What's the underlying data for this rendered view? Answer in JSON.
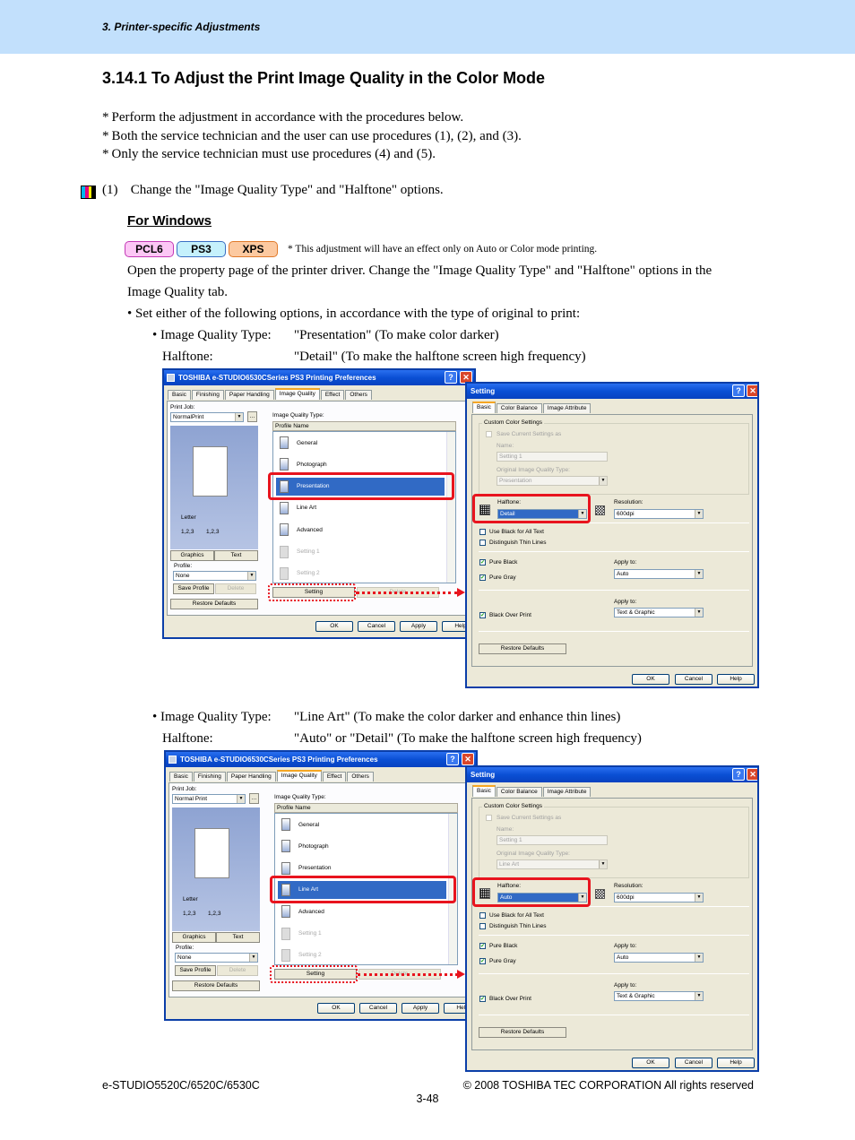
{
  "header": {
    "section": "3. Printer-specific Adjustments",
    "band_color": "#c2e0fc"
  },
  "title": "3.14.1 To Adjust the Print Image Quality in the Color Mode",
  "notes": [
    "Perform the adjustment in accordance with the procedures below.",
    "Both the service technician and the user can use procedures (1), (2), and (3).",
    "Only the service technician must use procedures (4) and (5)."
  ],
  "step": {
    "number": "(1)",
    "text": "Change the \"Image Quality Type\" and \"Halftone\" options.",
    "icon": "cmy-color-icon",
    "icon_colors": [
      "#00b7ef",
      "#e5007e",
      "#fff100",
      "#000000"
    ]
  },
  "for_windows": "For Windows",
  "badges": [
    {
      "label": "PCL6",
      "bg": "#fcc7f5",
      "border": "#c33ab6"
    },
    {
      "label": "PS3",
      "bg": "#c5f1fc",
      "border": "#3a6fc3"
    },
    {
      "label": "XPS",
      "bg": "#fcc9a0",
      "border": "#e07a2a"
    }
  ],
  "badge_note": "* This adjustment will have an effect only on Auto or Color mode printing.",
  "paragraph": "Open the property page of the printer driver.  Change the \"Image Quality Type\" and \"Halftone\" options in the Image Quality tab.",
  "bullet": "• Set either of the following options, in accordance with the type of original to print:",
  "options": [
    {
      "iq_label": "• Image Quality Type:",
      "iq_value": "\"Presentation\" (To make color darker)",
      "ht_label": "Halftone:",
      "ht_value": "\"Detail\" (To make the halftone screen high frequency)"
    },
    {
      "iq_label": "• Image Quality Type:",
      "iq_value": "\"Line Art\" (To make the color darker and enhance thin lines)",
      "ht_label": "Halftone:",
      "ht_value": "\"Auto\" or \"Detail\" (To make the halftone screen high frequency)"
    }
  ],
  "screenshots": [
    {
      "prefs": {
        "title": "TOSHIBA e-STUDIO6530CSeries PS3 Printing Preferences",
        "tabs": [
          "Basic",
          "Finishing",
          "Paper Handling",
          "Image Quality",
          "Effect",
          "Others"
        ],
        "print_job_label": "Print Job:",
        "print_job_value": "NormalPrint",
        "paper_label": "Letter",
        "collate_a": "1,2,3",
        "collate_b": "1,2,3",
        "graphics_tab": "Graphics",
        "text_tab": "Text",
        "profile_label": "Profile:",
        "profile_value": "None",
        "save_profile": "Save Profile",
        "delete": "Delete",
        "restore_defaults": "Restore Defaults",
        "iq_type_label": "Image Quality Type:",
        "profile_name_header": "Profile Name",
        "items": [
          {
            "label": "General",
            "state": "normal"
          },
          {
            "label": "Photograph",
            "state": "normal"
          },
          {
            "label": "Presentation",
            "state": "selected"
          },
          {
            "label": "Line Art",
            "state": "normal"
          },
          {
            "label": "Advanced",
            "state": "normal"
          },
          {
            "label": "Setting 1",
            "state": "disabled"
          },
          {
            "label": "Setting 2",
            "state": "disabled"
          }
        ],
        "setting_button": "Setting",
        "delete2": "Delete",
        "ok": "OK",
        "cancel": "Cancel",
        "apply": "Apply",
        "help": "Help"
      },
      "setting": {
        "title": "Setting",
        "tabs": [
          "Basic",
          "Color Balance",
          "Image Attribute"
        ],
        "group_label": "Custom Color Settings",
        "save_current": "Save Current Settings as",
        "name_label": "Name:",
        "name_value": "Setting 1",
        "orig_label": "Original Image Quality Type:",
        "orig_value": "Presentation",
        "halftone_label": "Halftone:",
        "halftone_value": "Detail",
        "resolution_label": "Resolution:",
        "resolution_value": "600dpi",
        "use_black": "Use Black for All Text",
        "distinguish": "Distinguish Thin Lines",
        "pure_black": "Pure Black",
        "pure_gray": "Pure Gray",
        "apply_to_label": "Apply to:",
        "apply_to_value": "Auto",
        "apply_to2_label": "Apply to:",
        "apply_to2_value": "Text & Graphic",
        "black_over_print": "Black Over Print",
        "restore_defaults": "Restore Defaults",
        "ok": "OK",
        "cancel": "Cancel",
        "help": "Help"
      }
    },
    {
      "prefs": {
        "title": "TOSHIBA e-STUDIO6530CSeries PS3 Printing Preferences",
        "tabs": [
          "Basic",
          "Finishing",
          "Paper Handling",
          "Image Quality",
          "Effect",
          "Others"
        ],
        "print_job_label": "Print Job:",
        "print_job_value": "Normal Print",
        "paper_label": "Letter",
        "collate_a": "1,2,3",
        "collate_b": "1,2,3",
        "graphics_tab": "Graphics",
        "text_tab": "Text",
        "profile_label": "Profile:",
        "profile_value": "None",
        "save_profile": "Save Profile",
        "delete": "Delete",
        "restore_defaults": "Restore Defaults",
        "iq_type_label": "Image Quality Type:",
        "profile_name_header": "Profile Name",
        "items": [
          {
            "label": "General",
            "state": "normal"
          },
          {
            "label": "Photograph",
            "state": "normal"
          },
          {
            "label": "Presentation",
            "state": "normal"
          },
          {
            "label": "Line Art",
            "state": "selected"
          },
          {
            "label": "Advanced",
            "state": "normal"
          },
          {
            "label": "Setting 1",
            "state": "disabled"
          },
          {
            "label": "Setting 2",
            "state": "disabled"
          }
        ],
        "setting_button": "Setting",
        "delete2": "Delete",
        "ok": "OK",
        "cancel": "Cancel",
        "apply": "Apply",
        "help": "Help"
      },
      "setting": {
        "title": "Setting",
        "tabs": [
          "Basic",
          "Color Balance",
          "Image Attribute"
        ],
        "group_label": "Custom Color Settings",
        "save_current": "Save Current Settings as",
        "name_label": "Name:",
        "name_value": "Setting 1",
        "orig_label": "Original Image Quality Type:",
        "orig_value": "Line Art",
        "halftone_label": "Halftone:",
        "halftone_value": "Auto",
        "resolution_label": "Resolution:",
        "resolution_value": "600dpi",
        "use_black": "Use Black for All Text",
        "distinguish": "Distinguish Thin Lines",
        "pure_black": "Pure Black",
        "pure_gray": "Pure Gray",
        "apply_to_label": "Apply to:",
        "apply_to_value": "Auto",
        "apply_to2_label": "Apply to:",
        "apply_to2_value": "Text & Graphic",
        "black_over_print": "Black Over Print",
        "restore_defaults": "Restore Defaults",
        "ok": "OK",
        "cancel": "Cancel",
        "help": "Help"
      }
    }
  ],
  "footer": {
    "model": "e-STUDIO5520C/6520C/6530C",
    "copyright": "© 2008 TOSHIBA TEC CORPORATION All rights reserved",
    "page": "3-48"
  }
}
